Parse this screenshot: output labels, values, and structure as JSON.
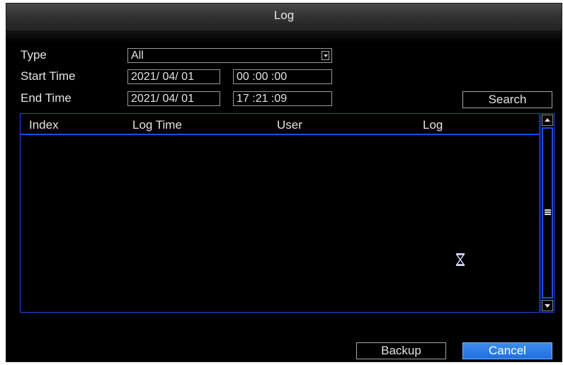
{
  "window": {
    "title": "Log"
  },
  "filters": {
    "type_label": "Type",
    "type_value": "All",
    "start_label": "Start Time",
    "start_date": "2021/ 04/ 01",
    "start_time": "00 :00 :00",
    "end_label": "End Time",
    "end_date": "2021/ 04/ 01",
    "end_time": "17 :21 :09",
    "search_label": "Search"
  },
  "table": {
    "columns": [
      "Index",
      "Log Time",
      "User",
      "Log"
    ],
    "rows": []
  },
  "footer": {
    "backup_label": "Backup",
    "cancel_label": "Cancel"
  },
  "icons": {
    "loading": "hourglass-icon",
    "scroll_up": "arrow-up-icon",
    "scroll_down": "arrow-down-icon",
    "scroll_grip": "scroll-grip-icon",
    "dropdown": "chevron-down-icon"
  },
  "colors": {
    "accent_border": "#1e4fd8",
    "primary_button": "#2f7de8",
    "background": "#000000",
    "text": "#e4e4e4"
  }
}
